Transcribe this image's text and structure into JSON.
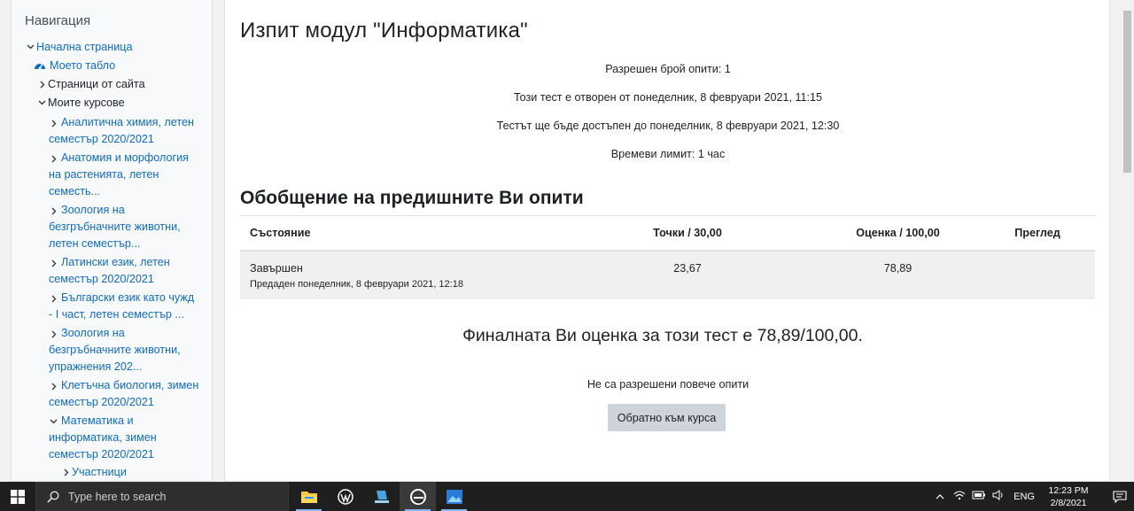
{
  "nav": {
    "title": "Навигация",
    "home": "Начална страница",
    "dashboard": "Моето табло",
    "site_pages": "Страници от сайта",
    "my_courses": "Моите курсове",
    "courses": [
      {
        "line1": "Аналитична химия, летен",
        "line2": "семестър 2020/2021"
      },
      {
        "line1": "Анатомия и морфология",
        "line2": "на растенията, летен",
        "line3": "семесть..."
      },
      {
        "line1": "Зоология на",
        "line2": "безгръбначните животни,",
        "line3": "летен семестър..."
      },
      {
        "line1": "Латински език, летен",
        "line2": "семестър 2020/2021"
      },
      {
        "line1": "Български език като чужд",
        "line2": "- I част, летен семестър ..."
      },
      {
        "line1": "Зоология на",
        "line2": "безгръбначните животни,",
        "line3": "упражнения 202..."
      },
      {
        "line1": "Клетъчна биология, зимен",
        "line2": "семестър 2020/2021"
      },
      {
        "line1": "Математика и",
        "line2": "информатика, зимен",
        "line3": "семестър 2020/2021"
      }
    ],
    "participants": "Участници"
  },
  "quiz": {
    "title": "Изпит модул \"Информатика\"",
    "attempts_allowed": "Разрешен брой опити: 1",
    "opened": "Този тест е отворен от понеделник, 8 февруари 2021, 11:15",
    "closes": "Тестът ще бъде достъпен до понеделник, 8 февруари 2021, 12:30",
    "time_limit": "Времеви лимит: 1 час",
    "summary_title": "Обобщение на предишните Ви опити",
    "table": {
      "headers": [
        "Състояние",
        "Точки / 30,00",
        "Оценка / 100,00",
        "Преглед"
      ],
      "rows": [
        {
          "state": "Завършен",
          "submitted": "Предаден понеделник, 8 февруари 2021, 12:18",
          "points": "23,67",
          "grade": "78,89",
          "review": ""
        }
      ]
    },
    "final_grade": "Финалната Ви оценка за този тест е 78,89/100,00.",
    "no_more_attempts": "Не са разрешени повече опити",
    "back_button": "Обратно към курса"
  },
  "taskbar": {
    "search_placeholder": "Type here to search",
    "language": "ENG",
    "time": "12:23 PM",
    "date": "2/8/2021"
  }
}
